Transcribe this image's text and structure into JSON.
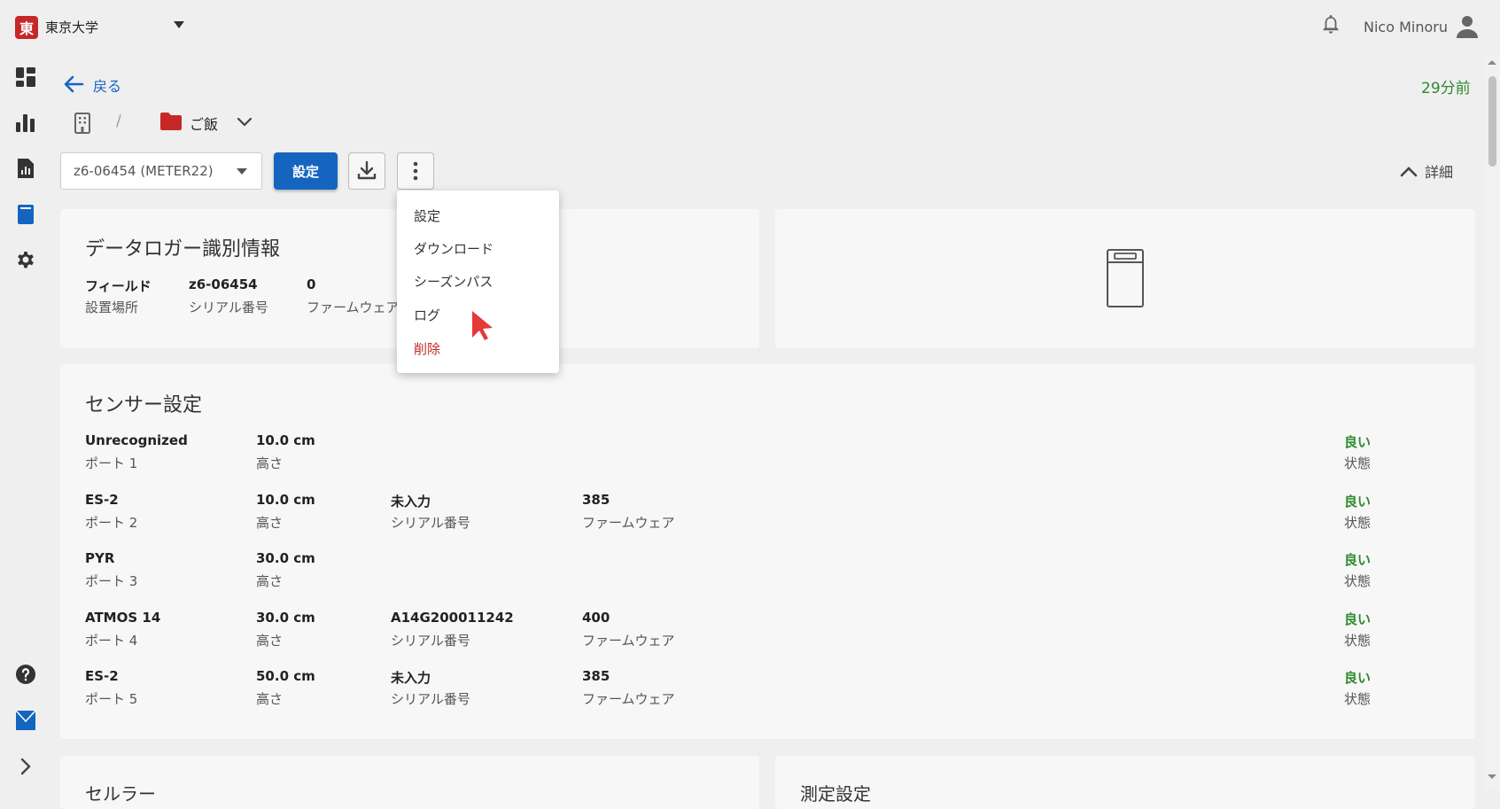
{
  "topbar": {
    "org_badge": "東",
    "org_name": "東京大学",
    "user_name": "Nico Minoru"
  },
  "header": {
    "back_label": "戻る",
    "updated": "29分前",
    "breadcrumb_sep": "/",
    "folder_name": "ご飯"
  },
  "toolbar": {
    "device_value": "z6-06454 (METER22)",
    "settings_label": "設定",
    "details_label": "詳細"
  },
  "menu": {
    "items": [
      "設定",
      "ダウンロード",
      "シーズンパス",
      "ログ",
      "削除"
    ]
  },
  "identity": {
    "title": "データロガー識別情報",
    "fields": [
      {
        "value": "フィールド",
        "label": "設置場所"
      },
      {
        "value": "z6-06454",
        "label": "シリアル番号"
      },
      {
        "value": "0",
        "label": "ファームウェア"
      }
    ]
  },
  "sensors": {
    "title": "センサー設定",
    "rows": [
      {
        "name": "Unrecognized",
        "port": "ポート 1",
        "height": "10.0 cm",
        "height_label": "高さ",
        "serial": "",
        "serial_label": "",
        "firmware": "",
        "firmware_label": "",
        "status": "良い",
        "status_label": "状態"
      },
      {
        "name": "ES-2",
        "port": "ポート 2",
        "height": "10.0 cm",
        "height_label": "高さ",
        "serial": "未入力",
        "serial_label": "シリアル番号",
        "firmware": "385",
        "firmware_label": "ファームウェア",
        "status": "良い",
        "status_label": "状態"
      },
      {
        "name": "PYR",
        "port": "ポート 3",
        "height": "30.0 cm",
        "height_label": "高さ",
        "serial": "",
        "serial_label": "",
        "firmware": "",
        "firmware_label": "",
        "status": "良い",
        "status_label": "状態"
      },
      {
        "name": "ATMOS 14",
        "port": "ポート 4",
        "height": "30.0 cm",
        "height_label": "高さ",
        "serial": "A14G200011242",
        "serial_label": "シリアル番号",
        "firmware": "400",
        "firmware_label": "ファームウェア",
        "status": "良い",
        "status_label": "状態"
      },
      {
        "name": "ES-2",
        "port": "ポート 5",
        "height": "50.0 cm",
        "height_label": "高さ",
        "serial": "未入力",
        "serial_label": "シリアル番号",
        "firmware": "385",
        "firmware_label": "ファームウェア",
        "status": "良い",
        "status_label": "状態"
      }
    ]
  },
  "bottom_cards": {
    "left_title": "セルラー",
    "right_title": "測定設定"
  },
  "colors": {
    "primary": "#1565c0",
    "danger": "#c62828",
    "good": "#2e8b2e",
    "cursor": "#e53935"
  }
}
